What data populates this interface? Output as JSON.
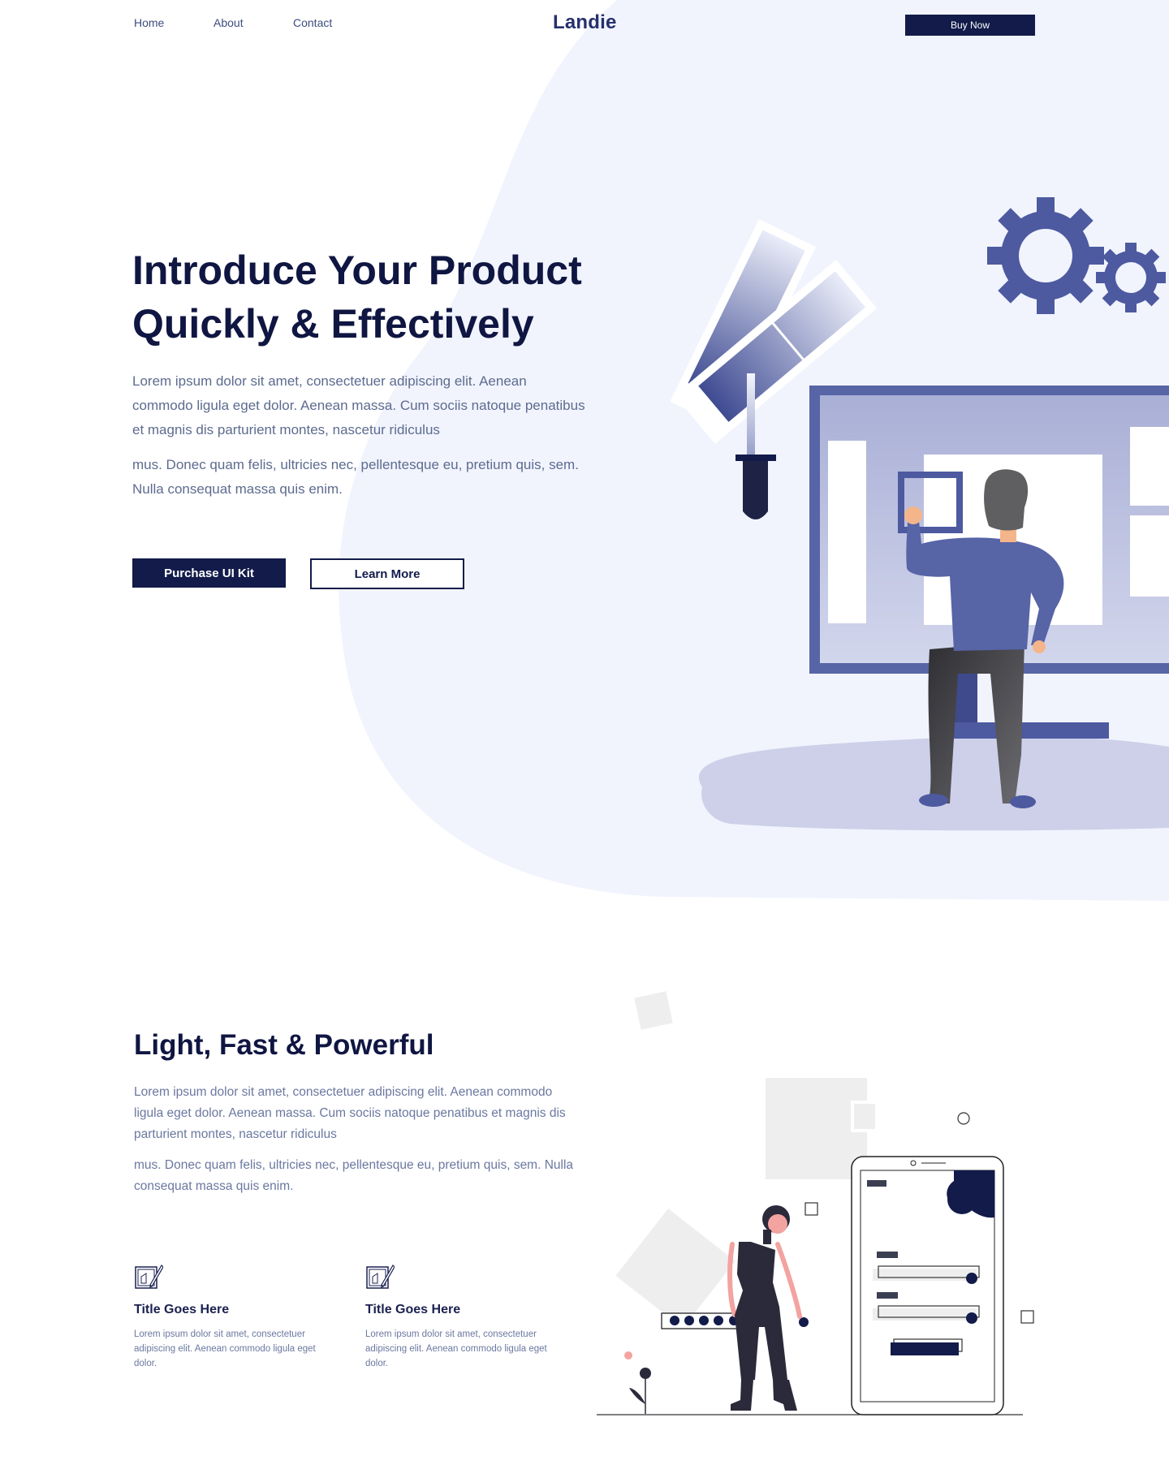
{
  "nav": {
    "links": [
      "Home",
      "About",
      "Contact"
    ],
    "logo": "Landie",
    "buy_label": "Buy Now"
  },
  "hero": {
    "title_line1": "Introduce Your Product",
    "title_line2": "Quickly & Effectively",
    "paragraph1": "Lorem ipsum dolor sit amet, consectetuer adipiscing elit. Aenean commodo ligula eget dolor. Aenean massa. Cum sociis natoque penatibus et magnis dis parturient montes, nascetur ridiculus",
    "paragraph2": "mus. Donec quam felis, ultricies nec, pellentesque eu, pretium quis, sem. Nulla consequat massa quis enim.",
    "primary_button": "Purchase UI Kit",
    "secondary_button": "Learn More"
  },
  "features_section": {
    "title": "Light, Fast & Powerful",
    "paragraph1": "Lorem ipsum dolor sit amet, consectetuer adipiscing elit. Aenean commodo ligula eget dolor. Aenean massa. Cum sociis natoque penatibus et magnis dis parturient montes, nascetur ridiculus",
    "paragraph2": "mus. Donec quam felis, ultricies nec, pellentesque eu, pretium quis, sem. Nulla consequat massa quis enim.",
    "features": [
      {
        "icon": "blueprint-pencil-icon",
        "title": "Title Goes Here",
        "text": "Lorem ipsum dolor sit amet, consectetuer adipiscing elit. Aenean commodo ligula eget dolor."
      },
      {
        "icon": "blueprint-pencil-icon",
        "title": "Title Goes Here",
        "text": "Lorem ipsum dolor sit amet, consectetuer adipiscing elit. Aenean commodo ligula eget dolor."
      }
    ]
  },
  "colors": {
    "primary": "#121b4a",
    "accent": "#5865a8",
    "hero_blob": "#f1f4fd",
    "heading": "#101642",
    "body_text": "#5d6b8f"
  }
}
